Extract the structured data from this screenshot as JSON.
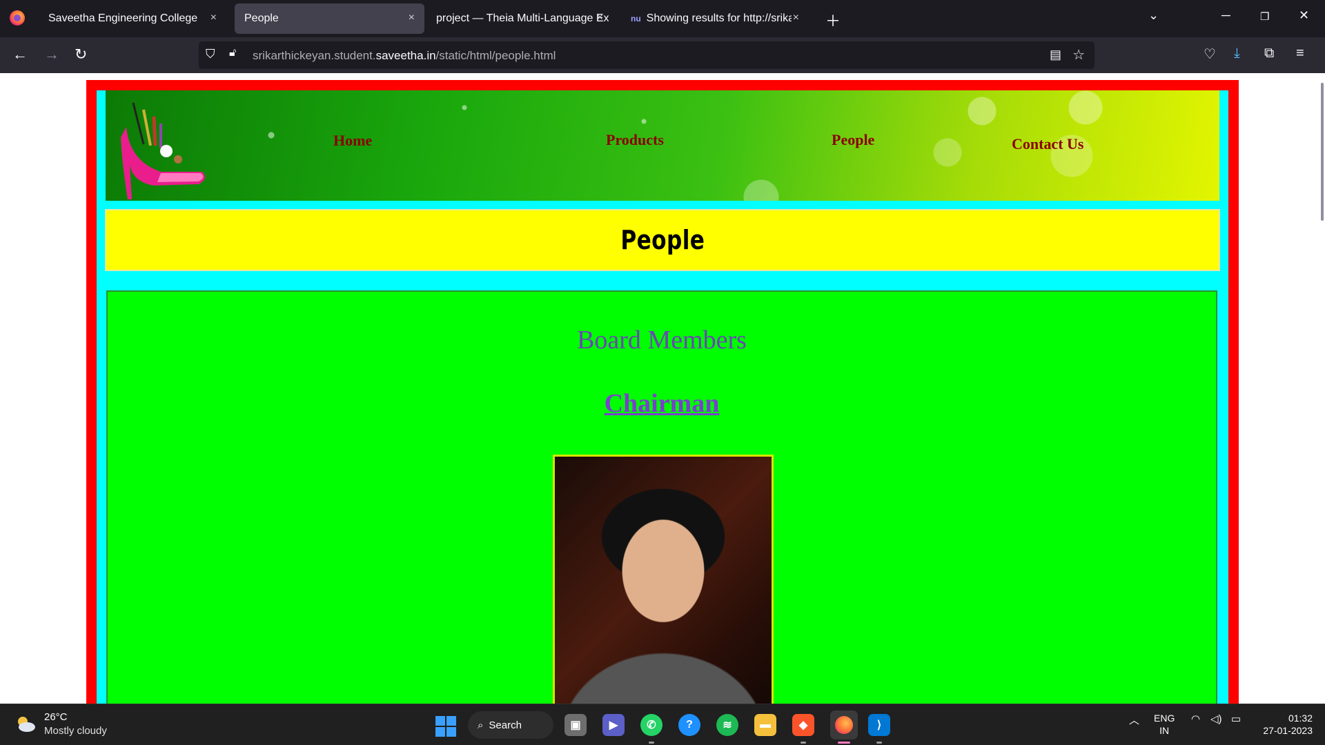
{
  "browser": {
    "tabs": [
      {
        "label": "Saveetha Engineering College",
        "active": false
      },
      {
        "label": "People",
        "active": true
      },
      {
        "label": "project — Theia Multi-Language Ex",
        "active": false
      },
      {
        "label": "Showing results for http://srikar",
        "active": false
      }
    ],
    "tab4_favicon": "nu",
    "close_glyph": "×",
    "url_prefix": "srikarthickeyan.student.",
    "url_domain": "saveetha.in",
    "url_path": "/static/html/people.html"
  },
  "page": {
    "nav": [
      "Home",
      "Products",
      "People",
      "Contact Us"
    ],
    "heading": "People",
    "section_title": "Board Members",
    "subsection": "Chairman",
    "colors": {
      "outer": "#ff0000",
      "frame": "#00ffff",
      "heading_bg": "#ffff00",
      "content_bg": "#00ff00",
      "nav_text": "#8b0000"
    }
  },
  "taskbar": {
    "temperature": "26°C",
    "weather": "Mostly cloudy",
    "search_label": "Search",
    "language": "ENG",
    "region": "IN",
    "time": "01:32",
    "date": "27-01-2023"
  }
}
